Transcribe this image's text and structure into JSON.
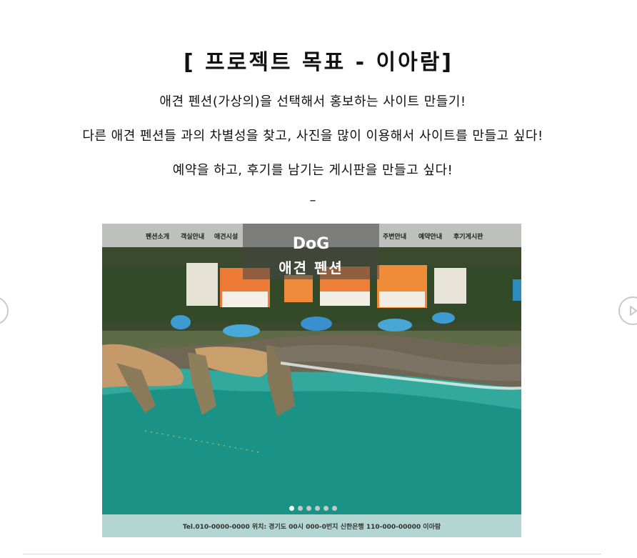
{
  "project": {
    "title": "[ 프로젝트 목표 - 이아람]",
    "lines": [
      "애견 펜션(가상의)을 선택해서 홍보하는 사이트 만들기!",
      "다른 애견 펜션들 과의 차별성을 찾고, 사진을 많이 이용해서 사이트를 만들고 싶다!",
      "예약을 하고, 후기를 남기는 게시판을 만들고 싶다!"
    ],
    "separator": "–"
  },
  "carousel": {
    "prev_icon": "chevron-left-icon",
    "next_icon": "play-right-icon",
    "nav_left": [
      "펜션소개",
      "객실안내",
      "애견시설"
    ],
    "nav_right": [
      "주변안내",
      "예약안내",
      "후기게시판"
    ],
    "brand": {
      "name": "DoG",
      "subtitle": "애견 펜션"
    },
    "slide_count": 6,
    "active_slide": 1,
    "footer": "Tel.010-0000-0000 위치: 경기도 00시 000-0번지 신한은행 110-000-00000 이아람",
    "colors": {
      "footer_bg": "#b4d6d2",
      "sea": "#1a9386",
      "nav_bg": "#cdcdcd"
    }
  }
}
